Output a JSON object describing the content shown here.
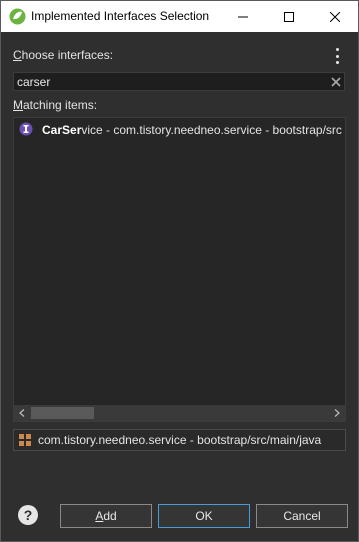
{
  "window": {
    "title": "Implemented Interfaces Selection"
  },
  "labels": {
    "choose_first": "C",
    "choose_rest": "hoose interfaces:",
    "matching_first": "M",
    "matching_rest": "atching items:"
  },
  "search": {
    "value": "carser"
  },
  "results": [
    {
      "match_prefix": "CarSer",
      "rest": "vice - com.tistory.needneo.service - bootstrap/src",
      "icon": "interface-icon"
    }
  ],
  "status": {
    "text": "com.tistory.needneo.service - bootstrap/src/main/java",
    "icon": "package-icon"
  },
  "buttons": {
    "add_mnemonic": "A",
    "add_rest": "dd",
    "ok": "OK",
    "cancel": "Cancel",
    "help": "?"
  },
  "colors": {
    "background": "#2f2f2f",
    "interface_icon": "#6b4fb3",
    "package_icon": "#c98a4b",
    "focus_border": "#4a9cd6"
  }
}
